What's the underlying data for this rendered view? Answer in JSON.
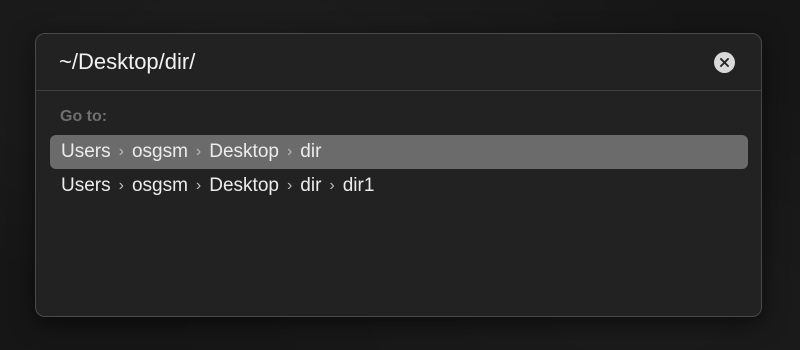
{
  "go_to_dialog": {
    "path_value": "~/Desktop/dir/",
    "clear_icon": "xmark-circle-icon",
    "section_label": "Go to:",
    "separator_glyph": "›",
    "suggestions": [
      {
        "selected": true,
        "segments": [
          "Users",
          "osgsm",
          "Desktop",
          "dir"
        ]
      },
      {
        "selected": false,
        "segments": [
          "Users",
          "osgsm",
          "Desktop",
          "dir",
          "dir1"
        ]
      }
    ]
  },
  "colors": {
    "selected_row": "#6b6b6b",
    "dialog_background": "#222222",
    "section_label": "#6f6f6f"
  }
}
